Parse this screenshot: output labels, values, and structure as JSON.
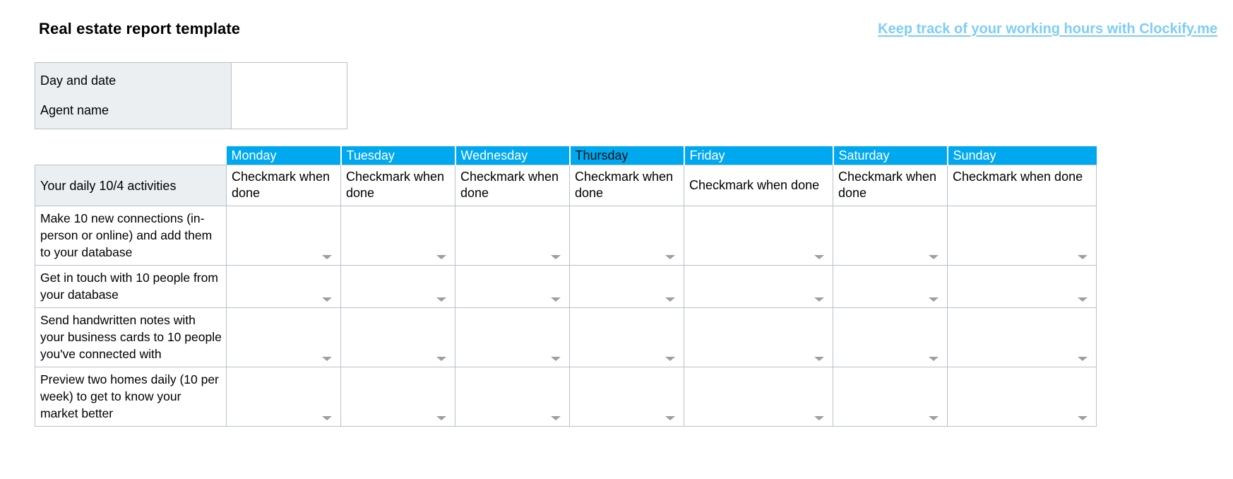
{
  "header": {
    "title": "Real estate report template",
    "promo_link": "Keep track of your working hours with Clockify.me",
    "promo_link_color": "#7ecdf7"
  },
  "info_table": {
    "label_line_1": "Day and date",
    "label_line_2": "Agent name",
    "value_1": "",
    "value_2": ""
  },
  "grid": {
    "accent_color": "#00a8f0",
    "header_bg": "#eceff1",
    "border_color": "#b6c2cb",
    "activity_column_header": "Your daily 10/4 activities",
    "days": [
      {
        "label": "Monday",
        "sub": "Checkmark when done",
        "text_color": "white"
      },
      {
        "label": "Tuesday",
        "sub": "Checkmark when done",
        "text_color": "white"
      },
      {
        "label": "Wednesday",
        "sub": "Checkmark when done",
        "text_color": "white"
      },
      {
        "label": "Thursday",
        "sub": "Checkmark when done",
        "text_color": "dark"
      },
      {
        "label": "Friday",
        "sub": "Checkmark when done",
        "text_color": "white"
      },
      {
        "label": "Saturday",
        "sub": "Checkmark when done",
        "text_color": "white"
      },
      {
        "label": "Sunday",
        "sub": "Checkmark when done",
        "text_color": "white"
      }
    ],
    "activities": [
      "Make 10 new connections (in-person or online) and add them to your database",
      "Get in touch with 10 people from your database",
      "Send handwritten notes with your business cards to 10 people you've connected with",
      "Preview two homes daily (10 per week) to get to know your market better"
    ],
    "cell_values": [
      [
        "",
        "",
        "",
        "",
        "",
        "",
        ""
      ],
      [
        "",
        "",
        "",
        "",
        "",
        "",
        ""
      ],
      [
        "",
        "",
        "",
        "",
        "",
        "",
        ""
      ],
      [
        "",
        "",
        "",
        "",
        "",
        "",
        ""
      ]
    ],
    "dropdown_icon": "chevron-down-icon"
  }
}
